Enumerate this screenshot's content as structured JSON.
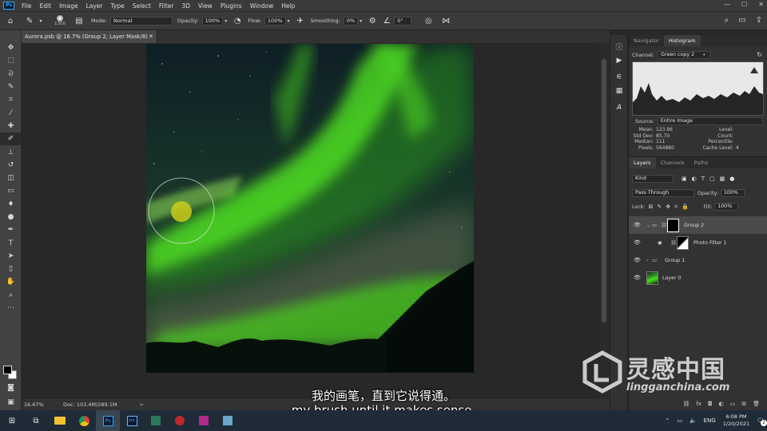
{
  "menubar": {
    "logo": "Ps",
    "items": [
      "File",
      "Edit",
      "Image",
      "Layer",
      "Type",
      "Select",
      "Filter",
      "3D",
      "View",
      "Plugins",
      "Window",
      "Help"
    ],
    "window_controls": [
      "—",
      "☐",
      "✕"
    ]
  },
  "options": {
    "brush_size": "1300",
    "mode_label": "Mode:",
    "mode_value": "Normal",
    "opacity_label": "Opacity:",
    "opacity_value": "100%",
    "flow_label": "Flow:",
    "flow_value": "100%",
    "smoothing_label": "Smoothing:",
    "smoothing_value": "0%",
    "angle_value": "0°"
  },
  "document": {
    "tab_title": "Aurora.psb @ 16.7% (Group 2, Layer Mask/8) *",
    "close": "×",
    "zoom": "16.67%",
    "doc_size": "Doc: 103.4M/289.1M",
    "status_arrow": ">"
  },
  "navigator": {
    "tabs": [
      "Navigator",
      "Histogram"
    ],
    "active_tab": "Histogram",
    "channel_label": "Channel:",
    "channel_value": "Green copy 2",
    "source_label": "Source:",
    "source_value": "Entire Image",
    "stats_left": [
      {
        "k": "Mean:",
        "v": "123.96"
      },
      {
        "k": "Std Dev:",
        "v": "85.70"
      },
      {
        "k": "Median:",
        "v": "111"
      },
      {
        "k": "Pixels:",
        "v": "564880"
      }
    ],
    "stats_right": [
      {
        "k": "Level:",
        "v": ""
      },
      {
        "k": "Count:",
        "v": ""
      },
      {
        "k": "Percentile:",
        "v": ""
      },
      {
        "k": "Cache Level:",
        "v": "4"
      }
    ]
  },
  "layers_panel": {
    "tabs": [
      "Layers",
      "Channels",
      "Paths"
    ],
    "active_tab": "Layers",
    "filter_kind": "Kind",
    "blend_mode": "Pass Through",
    "opacity_label": "Opacity:",
    "opacity_value": "100%",
    "lock_label": "Lock:",
    "fill_label": "Fill:",
    "fill_value": "100%",
    "layers": [
      {
        "name": "Group 2",
        "type": "group",
        "expanded": true,
        "selected": true
      },
      {
        "name": "Photo Filter 1",
        "type": "adjustment",
        "selected": false
      },
      {
        "name": "Group 1",
        "type": "group",
        "expanded": false,
        "selected": false
      },
      {
        "name": "Layer 0",
        "type": "pixel",
        "selected": false
      }
    ],
    "footer_icons": [
      "link-icon",
      "fx-icon",
      "mask-icon",
      "adjustment-icon",
      "folder-icon",
      "new-layer-icon",
      "trash-icon"
    ],
    "footer_fx": "fx"
  },
  "subtitles": {
    "zh": "我的画笔，直到它说得通。",
    "en": "my brush until it makes sense."
  },
  "watermark": {
    "cn": "灵感中国",
    "url": "lingganchina.com"
  },
  "taskbar": {
    "lang": "ENG",
    "time": "6:08 PM",
    "date": "1/20/2021",
    "notification_count": "2"
  },
  "colors": {
    "accent": "#31a8ff",
    "aurora_green": "#46e01a",
    "sky": "#0e1f26"
  }
}
